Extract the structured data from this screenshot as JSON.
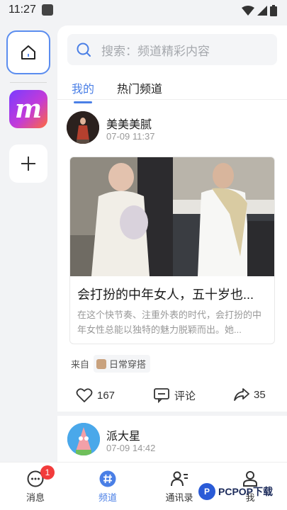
{
  "status_bar": {
    "time": "11:27"
  },
  "search": {
    "placeholder": "搜索：频道精彩内容"
  },
  "tabs": [
    {
      "label": "我的",
      "active": true
    },
    {
      "label": "热门频道",
      "active": false
    }
  ],
  "posts": [
    {
      "author": "美美美腻",
      "time": "07-09 11:37",
      "title": "会打扮的中年女人，五十岁也...",
      "description": "在这个快节奏、注重外表的时代，会打扮的中年女性总能以独特的魅力脱颖而出。她...",
      "from_label": "来自",
      "channel": "日常穿搭",
      "likes": "167",
      "comment_label": "评论",
      "shares": "35"
    },
    {
      "author": "派大星",
      "time": "07-09 14:42"
    }
  ],
  "bottom_nav": [
    {
      "label": "消息",
      "badge": "1"
    },
    {
      "label": "频道",
      "active": true
    },
    {
      "label": "通讯录"
    },
    {
      "label": "我"
    }
  ],
  "watermark": {
    "logo": "P",
    "text": "PCPOP下载"
  },
  "colors": {
    "accent": "#4a7fe6",
    "badge": "#f23b3b"
  }
}
